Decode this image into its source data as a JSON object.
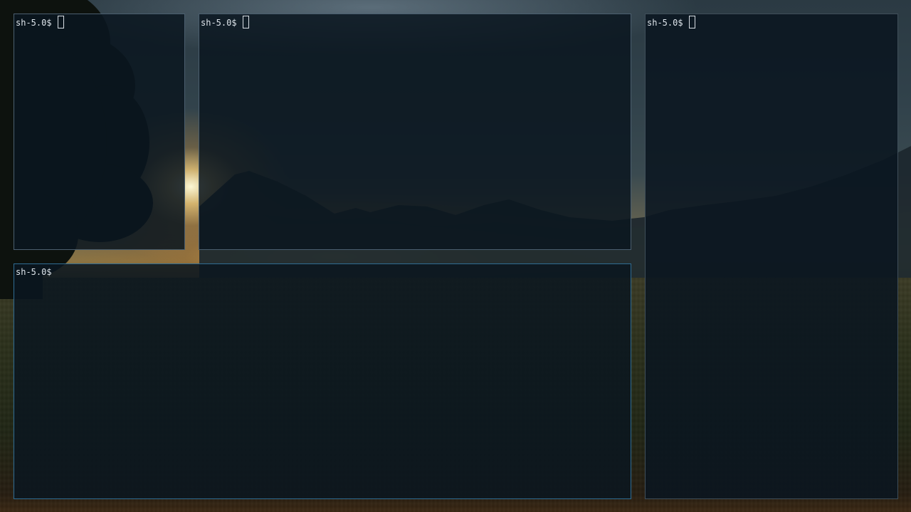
{
  "desktop": {
    "wallpaper": "sunset-meadow-with-mountains",
    "accent_focus_border": "#2f6c93",
    "inactive_border": "#4b5f6f"
  },
  "terminals": [
    {
      "id": "term-top-left",
      "prompt": "sh-5.0$",
      "cursor_style": "hollow-block"
    },
    {
      "id": "term-top-center",
      "prompt": "sh-5.0$",
      "cursor_style": "hollow-block"
    },
    {
      "id": "term-right",
      "prompt": "sh-5.0$",
      "cursor_style": "hollow-block"
    },
    {
      "id": "term-bottom-left",
      "prompt": "sh-5.0$",
      "cursor_style": "none",
      "focused": true
    }
  ]
}
